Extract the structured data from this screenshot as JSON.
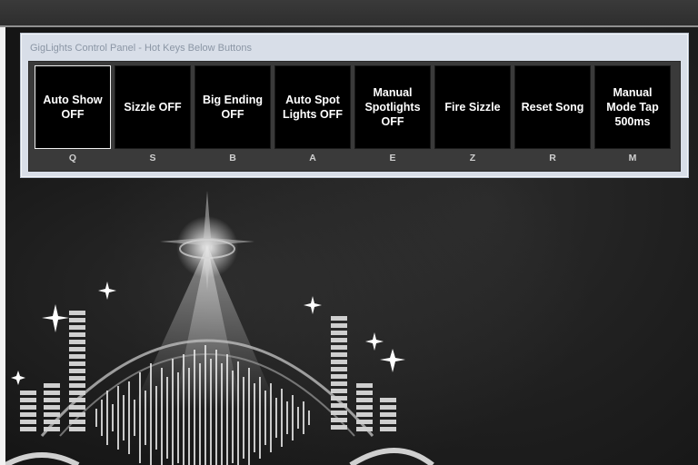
{
  "panel": {
    "title": "GigLights Control Panel - Hot Keys Below Buttons",
    "buttons": [
      {
        "label": "Auto Show OFF",
        "key": "Q"
      },
      {
        "label": "Sizzle OFF",
        "key": "S"
      },
      {
        "label": "Big Ending OFF",
        "key": "B"
      },
      {
        "label": "Auto Spot Lights OFF",
        "key": "A"
      },
      {
        "label": "Manual Spotlights OFF",
        "key": "E"
      },
      {
        "label": "Fire Sizzle",
        "key": "Z"
      },
      {
        "label": "Reset Song",
        "key": "R"
      },
      {
        "label": "Manual Mode Tap 500ms",
        "key": "M"
      }
    ]
  },
  "colors": {
    "button_bg": "#000000",
    "panel_bg": "#3a3a3a",
    "window_bg": "#d8dee8"
  }
}
